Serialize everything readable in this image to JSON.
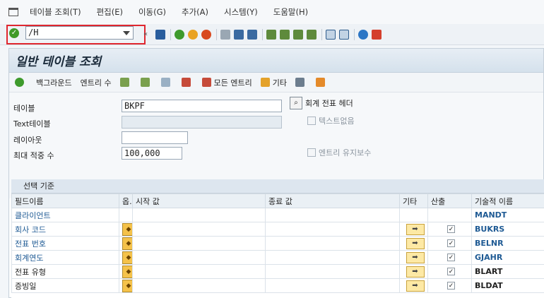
{
  "menu": {
    "items": [
      "테이블 조회(T)",
      "편집(E)",
      "이동(G)",
      "추가(A)",
      "시스템(Y)",
      "도움말(H)"
    ]
  },
  "toolbar": {
    "command_value": "/H",
    "icons": [
      "save-icon",
      "back-icon",
      "exit-icon",
      "cancel-icon",
      "print-icon",
      "find-icon",
      "find-next-icon",
      "first-page-icon",
      "prev-page-icon",
      "next-page-icon",
      "last-page-icon",
      "new-session-icon",
      "shortcut-icon",
      "help-icon",
      "settings-icon"
    ]
  },
  "window": {
    "title": "일반 테이블 조회"
  },
  "app_toolbar": {
    "background_label": "백그라운드",
    "entry_count_label": "엔트리 수",
    "all_entries_label": "모든 엔트리",
    "other_label": "기타"
  },
  "form": {
    "table_label": "테이블",
    "table_value": "BKPF",
    "text_table_label": "Text테이블",
    "text_table_value": "",
    "layout_label": "레이아웃",
    "layout_value": "",
    "max_hits_label": "최대 적중 수",
    "max_hits_value": "100,000",
    "header_button_label": "회계 전표 헤더",
    "no_text_label": "텍스트없음",
    "maintain_entries_label": "엔트리 유지보수"
  },
  "criteria": {
    "title": "선택 기준",
    "columns": [
      "필드이름",
      "옵.",
      "시작 값",
      "종료 값",
      "기타",
      "산출",
      "기술적 이름"
    ],
    "rows": [
      {
        "field": "클라이언트",
        "tech": "MANDT",
        "has_option": false,
        "has_other": false,
        "output": false,
        "dark": false
      },
      {
        "field": "회사 코드",
        "tech": "BUKRS",
        "has_option": true,
        "has_other": true,
        "output": true,
        "dark": false
      },
      {
        "field": "전표 번호",
        "tech": "BELNR",
        "has_option": true,
        "has_other": true,
        "output": true,
        "dark": false
      },
      {
        "field": "회계연도",
        "tech": "GJAHR",
        "has_option": true,
        "has_other": true,
        "output": true,
        "dark": false
      },
      {
        "field": "전표 유형",
        "tech": "BLART",
        "has_option": true,
        "has_other": true,
        "output": true,
        "dark": true
      },
      {
        "field": "증빙일",
        "tech": "BLDAT",
        "has_option": true,
        "has_other": true,
        "output": true,
        "dark": true
      }
    ]
  }
}
